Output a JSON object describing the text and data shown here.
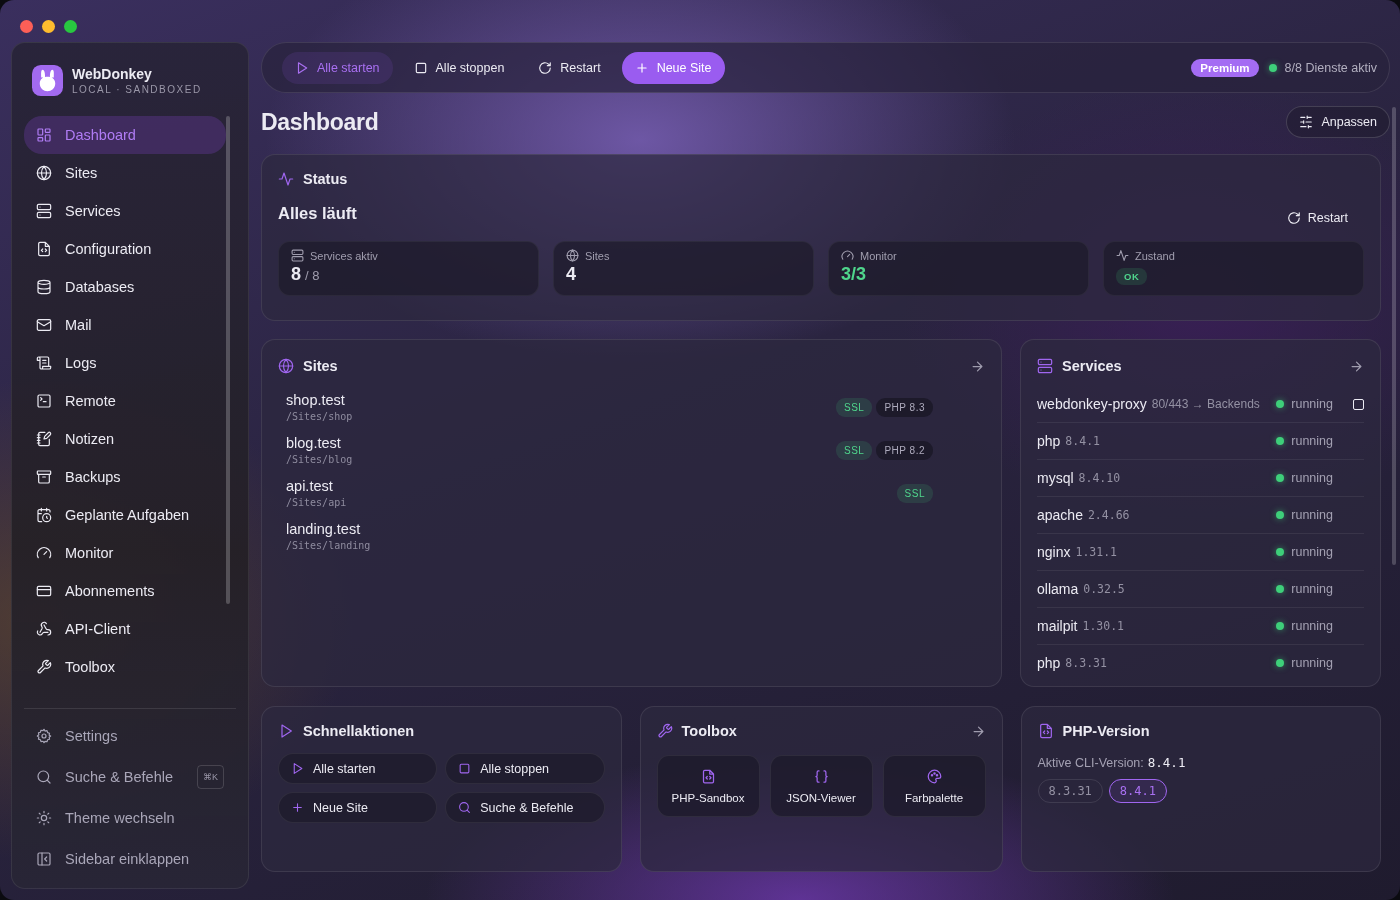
{
  "app": {
    "name": "WebDonkey",
    "subtitle": "LOCAL · SANDBOXED"
  },
  "sidebar": {
    "items": [
      {
        "label": "Dashboard",
        "selected": true
      },
      {
        "label": "Sites",
        "selected": false
      },
      {
        "label": "Services",
        "selected": false
      },
      {
        "label": "Configuration",
        "selected": false
      },
      {
        "label": "Databases",
        "selected": false
      },
      {
        "label": "Mail",
        "selected": false
      },
      {
        "label": "Logs",
        "selected": false
      },
      {
        "label": "Remote",
        "selected": false
      },
      {
        "label": "Notizen",
        "selected": false
      },
      {
        "label": "Backups",
        "selected": false
      },
      {
        "label": "Geplante Aufgaben",
        "selected": false
      },
      {
        "label": "Monitor",
        "selected": false
      },
      {
        "label": "Abonnements",
        "selected": false
      },
      {
        "label": "API-Client",
        "selected": false
      },
      {
        "label": "Toolbox",
        "selected": false
      }
    ],
    "footer_items": [
      {
        "label": "Settings"
      },
      {
        "label": "Suche & Befehle",
        "shortcut": "⌘K"
      },
      {
        "label": "Theme wechseln"
      },
      {
        "label": "Sidebar einklappen"
      }
    ]
  },
  "toolbar": {
    "buttons": [
      {
        "label": "Alle starten",
        "kind": "accent"
      },
      {
        "label": "Alle stoppen",
        "kind": "plain"
      },
      {
        "label": "Restart",
        "kind": "plain"
      },
      {
        "label": "Neue Site",
        "kind": "primary"
      }
    ],
    "plan_badge": "Premium",
    "status": "8/8 Dienste aktiv",
    "all_running": true
  },
  "page": {
    "title": "Dashboard",
    "customize_button": "Anpassen"
  },
  "status": {
    "title": "Status",
    "summary": "Alles läuft",
    "restart_button": "Restart",
    "tiles": [
      {
        "label": "Services aktiv",
        "kind": "count",
        "value": "8",
        "total": "/ 8"
      },
      {
        "label": "Sites",
        "kind": "number",
        "value": "4"
      },
      {
        "label": "Monitor",
        "kind": "good",
        "value": "3/3"
      },
      {
        "label": "Zustand",
        "kind": "badge",
        "value": "OK"
      }
    ]
  },
  "sites": {
    "title": "Sites",
    "rows": [
      {
        "name": "shop.test",
        "path": "/Sites/shop",
        "tags": [
          {
            "label": "SSL",
            "kind": "ssl"
          },
          {
            "label": "PHP 8.3",
            "kind": "php"
          }
        ]
      },
      {
        "name": "blog.test",
        "path": "/Sites/blog",
        "tags": [
          {
            "label": "SSL",
            "kind": "ssl"
          },
          {
            "label": "PHP 8.2",
            "kind": "php"
          }
        ]
      },
      {
        "name": "api.test",
        "path": "/Sites/api",
        "tags": [
          {
            "label": "SSL",
            "kind": "ssl"
          }
        ]
      },
      {
        "name": "landing.test",
        "path": "/Sites/landing",
        "tags": []
      }
    ]
  },
  "services": {
    "title": "Services",
    "rows": [
      {
        "name": "webdonkey-proxy",
        "detail": "80/443 → Backends",
        "status": "running",
        "running": true,
        "stoppable": true
      },
      {
        "name": "php",
        "version": "8.4.1",
        "status": "running",
        "running": true,
        "stoppable": false
      },
      {
        "name": "mysql",
        "version": "8.4.10",
        "status": "running",
        "running": true,
        "stoppable": false
      },
      {
        "name": "apache",
        "version": "2.4.66",
        "status": "running",
        "running": true,
        "stoppable": false
      },
      {
        "name": "nginx",
        "version": "1.31.1",
        "status": "running",
        "running": true,
        "stoppable": false
      },
      {
        "name": "ollama",
        "version": "0.32.5",
        "status": "running",
        "running": true,
        "stoppable": false
      },
      {
        "name": "mailpit",
        "version": "1.30.1",
        "status": "running",
        "running": true,
        "stoppable": false
      },
      {
        "name": "php",
        "version": "8.3.31",
        "status": "running",
        "running": true,
        "stoppable": false
      }
    ]
  },
  "quick_actions": {
    "title": "Schnellaktionen",
    "actions": [
      "Alle starten",
      "Alle stoppen",
      "Neue Site",
      "Suche & Befehle"
    ]
  },
  "toolbox": {
    "title": "Toolbox",
    "tools": [
      "PHP-Sandbox",
      "JSON-Viewer",
      "Farbpalette"
    ]
  },
  "php_version": {
    "title": "PHP-Version",
    "label": "Aktive CLI-Version:",
    "current": "8.4.1",
    "versions": [
      {
        "label": "8.3.31",
        "selected": false
      },
      {
        "label": "8.4.1",
        "selected": true
      }
    ]
  }
}
